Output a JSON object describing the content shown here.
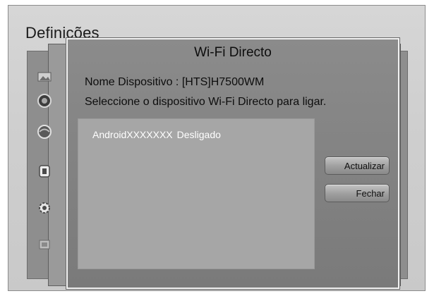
{
  "settings": {
    "title": "Definições"
  },
  "sidebar": {
    "icons": [
      "image-icon",
      "globe-icon",
      "network-icon",
      "box-icon",
      "gear-icon",
      "help-icon"
    ]
  },
  "dialog": {
    "title": "Wi-Fi Directo",
    "device_name_line": "Nome Dispositivo : [HTS]H7500WM",
    "instruction": "Seleccione o dispositivo Wi-Fi Directo para ligar.",
    "devices": [
      {
        "name": "AndroidXXXXXXX",
        "status": "Desligado"
      }
    ],
    "buttons": {
      "refresh_label": "Actualizar",
      "close_label": "Fechar"
    }
  }
}
